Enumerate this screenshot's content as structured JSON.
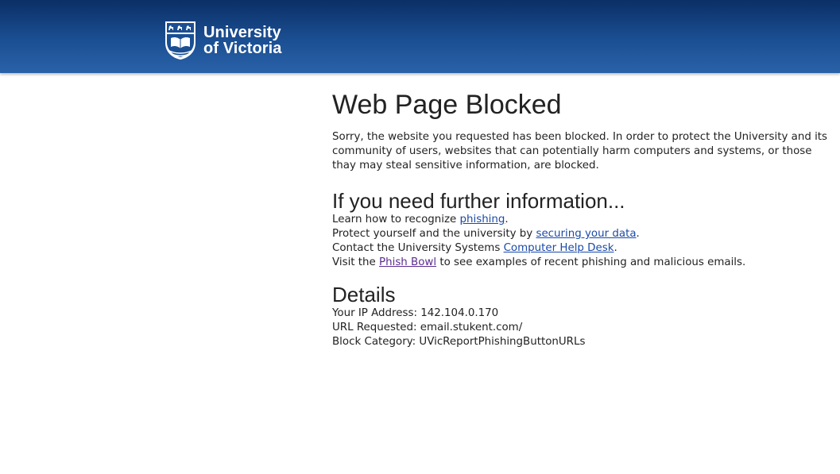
{
  "header": {
    "logo_line1": "University",
    "logo_line2": "of Victoria",
    "logo_icon": "uvic-crest-icon",
    "colors": {
      "top": "#0b2f66",
      "bottom": "#2a62a8"
    }
  },
  "main": {
    "title": "Web Page Blocked",
    "intro": "Sorry, the website you requested has been blocked. In order to protect the University and its community of users, websites that can potentially harm computers and systems, or those thay may steal sensitive information, are blocked."
  },
  "info": {
    "heading": "If you need further information...",
    "line1_pre": "Learn how to recognize ",
    "line1_link": "phishing",
    "line1_post": ".",
    "line2_pre": "Protect yourself and the university by ",
    "line2_link": "securing your data",
    "line2_post": ".",
    "line3_pre": "Contact the University Systems ",
    "line3_link": "Computer Help Desk",
    "line3_post": ".",
    "line4_pre": "Visit the ",
    "line4_link": "Phish Bowl",
    "line4_post": " to see examples of recent phishing and malicious emails."
  },
  "details": {
    "heading": "Details",
    "ip": "Your IP Address: 142.104.0.170",
    "url": "URL Requested: email.stukent.com/",
    "category": "Block Category: UVicReportPhishingButtonURLs"
  },
  "colors": {
    "link": "#1a4aa8",
    "visited_link": "#5b2c8f",
    "text": "#222222"
  }
}
